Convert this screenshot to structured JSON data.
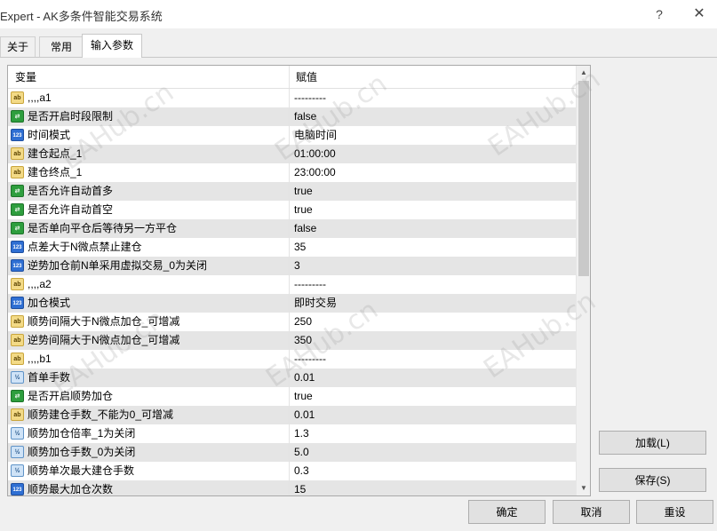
{
  "window": {
    "title": "Expert - AK多条件智能交易系统",
    "help_label": "?",
    "close_label": "✕"
  },
  "tabs": [
    {
      "label": "关于"
    },
    {
      "label": "常用"
    },
    {
      "label": "输入参数",
      "active": true
    }
  ],
  "grid": {
    "col_variable": "变量",
    "col_value": "赋值",
    "rows": [
      {
        "type": "ab",
        "icon": "ab",
        "name": ",,,,a1",
        "value": "---------"
      },
      {
        "type": "bool",
        "icon": "⇄",
        "name": "是否开启时段限制",
        "value": "false"
      },
      {
        "type": "int",
        "icon": "123",
        "name": "时间模式",
        "value": "电脑时间"
      },
      {
        "type": "ab",
        "icon": "ab",
        "name": "建仓起点_1",
        "value": "01:00:00"
      },
      {
        "type": "ab",
        "icon": "ab",
        "name": "建仓终点_1",
        "value": "23:00:00"
      },
      {
        "type": "bool",
        "icon": "⇄",
        "name": "是否允许自动首多",
        "value": "true"
      },
      {
        "type": "bool",
        "icon": "⇄",
        "name": "是否允许自动首空",
        "value": "true"
      },
      {
        "type": "bool",
        "icon": "⇄",
        "name": "是否单向平仓后等待另一方平仓",
        "value": "false"
      },
      {
        "type": "int",
        "icon": "123",
        "name": "点差大于N微点禁止建仓",
        "value": "35"
      },
      {
        "type": "int",
        "icon": "123",
        "name": "逆势加仓前N单采用虚拟交易_0为关闭",
        "value": "3"
      },
      {
        "type": "ab",
        "icon": "ab",
        "name": ",,,,a2",
        "value": "---------"
      },
      {
        "type": "int",
        "icon": "123",
        "name": "加仓模式",
        "value": "即时交易"
      },
      {
        "type": "ab",
        "icon": "ab",
        "name": "顺势间隔大于N微点加仓_可增减",
        "value": "250"
      },
      {
        "type": "ab",
        "icon": "ab",
        "name": "逆势间隔大于N微点加仓_可增减",
        "value": "350"
      },
      {
        "type": "ab",
        "icon": "ab",
        "name": ",,,,b1",
        "value": "---------"
      },
      {
        "type": "float",
        "icon": "½",
        "name": "首单手数",
        "value": "0.01"
      },
      {
        "type": "bool",
        "icon": "⇄",
        "name": "是否开启顺势加仓",
        "value": "true"
      },
      {
        "type": "ab",
        "icon": "ab",
        "name": "顺势建仓手数_不能为0_可增减",
        "value": "0.01"
      },
      {
        "type": "float",
        "icon": "½",
        "name": "顺势加仓倍率_1为关闭",
        "value": "1.3"
      },
      {
        "type": "float",
        "icon": "½",
        "name": "顺势加仓手数_0为关闭",
        "value": "5.0"
      },
      {
        "type": "float",
        "icon": "½",
        "name": "顺势单次最大建仓手数",
        "value": "0.3"
      },
      {
        "type": "int",
        "icon": "123",
        "name": "顺势最大加仓次数",
        "value": "15"
      }
    ]
  },
  "buttons": {
    "load": "加载(L)",
    "save": "保存(S)",
    "ok": "确定",
    "cancel": "取消",
    "reset": "重设"
  },
  "watermark": "EAHub.cn"
}
